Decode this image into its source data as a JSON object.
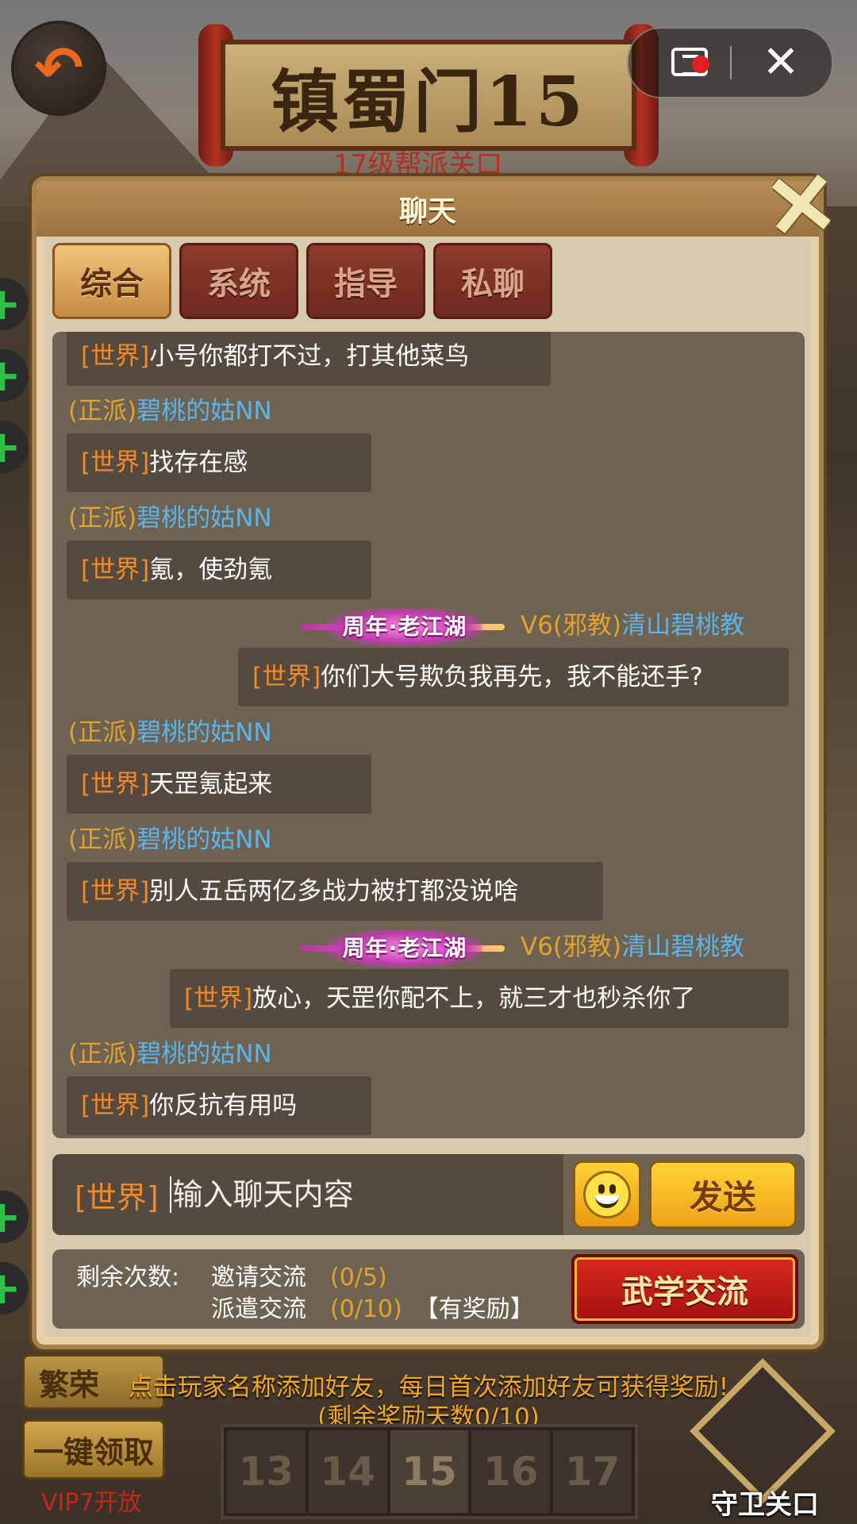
{
  "game": {
    "stage_title": "镇蜀门15",
    "stage_subtitle": "17级帮派关口",
    "guard_label": "守卫关口",
    "fanrong_label": "繁荣",
    "one_key_label": "一键领取",
    "vip_note": "VIP7开放",
    "levels": [
      "13",
      "14",
      "15",
      "16",
      "17"
    ]
  },
  "chat": {
    "title": "聊天",
    "tabs": [
      {
        "label": "综合",
        "active": true
      },
      {
        "label": "系统",
        "active": false
      },
      {
        "label": "指导",
        "active": false
      },
      {
        "label": "私聊",
        "active": false
      }
    ],
    "anniversary_badge": "周年·老江湖",
    "messages": [
      {
        "side": "left",
        "channel": "[世界]",
        "text": "小号你都打不过，打其他菜鸟"
      },
      {
        "side": "left",
        "sender_prefix": "(正派)",
        "sender_name": "碧桃的姑NN",
        "channel": "[世界]",
        "text": "找存在感"
      },
      {
        "side": "left",
        "sender_prefix": "(正派)",
        "sender_name": "碧桃的姑NN",
        "channel": "[世界]",
        "text": "氪，使劲氪"
      },
      {
        "side": "right",
        "sender_prefix": "V6(邪教)",
        "sender_name": "清山碧桃教",
        "channel": "[世界]",
        "text": "你们大号欺负我再先，我不能还手?"
      },
      {
        "side": "left",
        "sender_prefix": "(正派)",
        "sender_name": "碧桃的姑NN",
        "channel": "[世界]",
        "text": "天罡氪起来"
      },
      {
        "side": "left",
        "sender_prefix": "(正派)",
        "sender_name": "碧桃的姑NN",
        "channel": "[世界]",
        "text": "别人五岳两亿多战力被打都没说啥"
      },
      {
        "side": "right",
        "sender_prefix": "V6(邪教)",
        "sender_name": "清山碧桃教",
        "channel": "[世界]",
        "text": "放心，天罡你配不上，就三才也秒杀你了"
      },
      {
        "side": "left",
        "sender_prefix": "(正派)",
        "sender_name": "碧桃的姑NN",
        "channel": "[世界]",
        "text": "你反抗有用吗"
      }
    ],
    "input": {
      "channel": "[世界]",
      "placeholder": "输入聊天内容",
      "send_label": "发送"
    },
    "exchange": {
      "remaining_label": "剩余次数:",
      "invite_label": "邀请交流",
      "invite_count": "(0/5)",
      "dispatch_label": "派遣交流",
      "dispatch_count": "(0/10)",
      "reward_note": "【有奖励】",
      "button_label": "武学交流"
    },
    "hint_line1": "点击玩家名称添加好友，每日首次添加好友可获得奖励!",
    "hint_line2": "(剩余奖励天数0/10)"
  },
  "colors": {
    "channel": "#f08a2a",
    "sender_prefix": "#e2a22e",
    "sender_name": "#5bb4ec",
    "message_text": "#ffffff",
    "hint": "#f4a822"
  }
}
